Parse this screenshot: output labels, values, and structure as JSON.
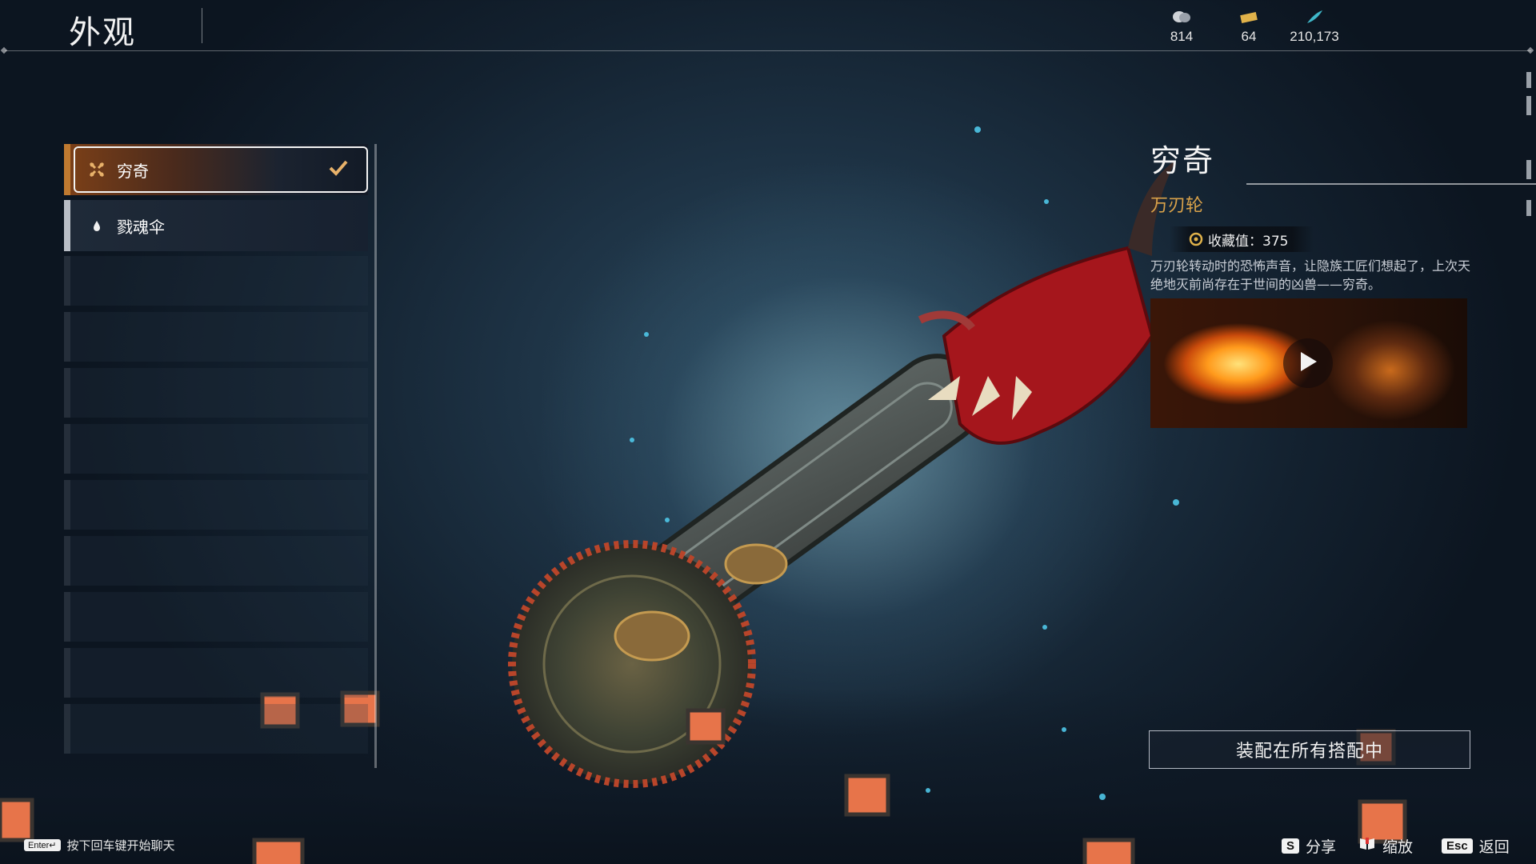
{
  "page": {
    "title": "外观"
  },
  "currencies": [
    {
      "icon": "coin-stack-icon",
      "value": "814"
    },
    {
      "icon": "ticket-icon",
      "value": "64"
    },
    {
      "icon": "feather-icon",
      "value": "210,173"
    }
  ],
  "list": {
    "items": [
      {
        "label": "穷奇",
        "icon": "weapon-type-icon",
        "selected": true
      },
      {
        "label": "戮魂伞",
        "icon": "drop-icon",
        "selected": false
      }
    ]
  },
  "detail": {
    "name": "穷奇",
    "subtitle": "万刃轮",
    "collect_label": "收藏值：375",
    "description": "万刃轮转动时的恐怖声音，让隐族工匠们想起了，上次天绝地灭前尚存在于世间的凶兽——穷奇。",
    "preview_icon": "play-icon"
  },
  "equip_button": {
    "label": "装配在所有搭配中"
  },
  "bottom": {
    "chat_key": "Enter↵",
    "chat_hint": "按下回车键开始聊天",
    "hints": [
      {
        "key": "S",
        "label": "分享"
      },
      {
        "key": "",
        "label": "缩放",
        "icon": "book-icon"
      },
      {
        "key": "Esc",
        "label": "返回"
      }
    ]
  },
  "colors": {
    "accent": "#d9a24a",
    "selected_bar": "#c07a30"
  }
}
